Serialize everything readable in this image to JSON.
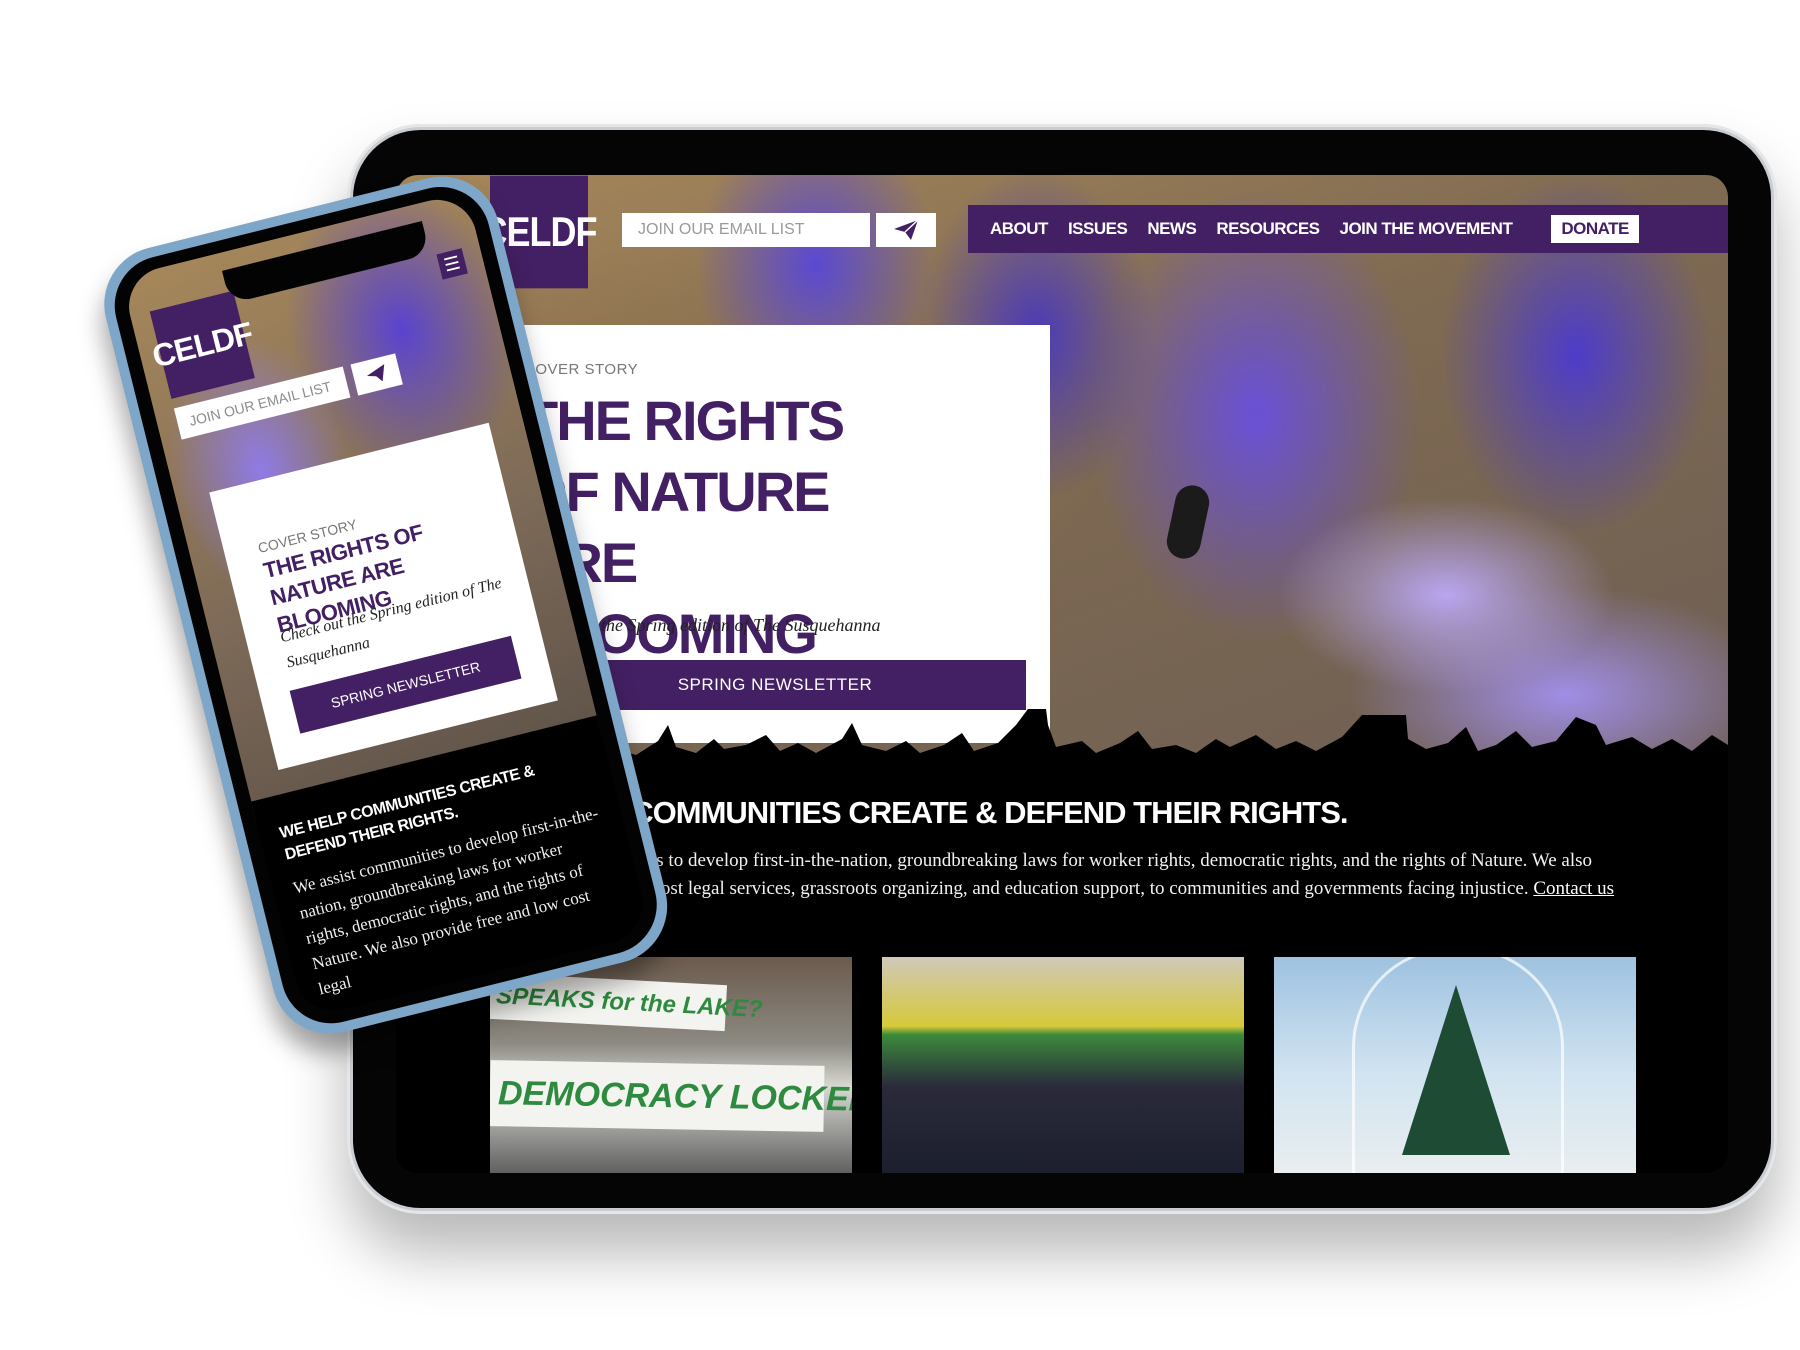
{
  "brand": {
    "logo_text": "CELDF",
    "accent": "#432063"
  },
  "header": {
    "email_placeholder": "JOIN OUR EMAIL LIST",
    "send_icon": "paper-plane-icon",
    "nav": [
      "ABOUT",
      "ISSUES",
      "NEWS",
      "RESOURCES",
      "JOIN THE MOVEMENT"
    ],
    "donate_label": "DONATE"
  },
  "cover": {
    "kicker": "COVER STORY",
    "title": "THE RIGHTS OF NATURE ARE BLOOMING",
    "subtitle": "Check out the Spring edition of The Susquehanna",
    "button_label": "SPRING NEWSLETTER"
  },
  "mission": {
    "heading": "WE HELP COMMUNITIES CREATE & DEFEND THEIR RIGHTS.",
    "body": "We assist communities to develop first-in-the-nation, groundbreaking laws for worker rights, democratic rights, and the rights of Nature. We also provide free and low cost legal services, grassroots organizing, and education support, to communities and governments facing injustice.",
    "link_label": "Contact us now",
    "link_suffix": "."
  },
  "thumbnails": {
    "banner_1": "SPEAKS for the LAKE?",
    "banner_2": "DEMOCRACY LOCKED OUT!"
  },
  "mobile": {
    "menu_icon": "hamburger-menu-icon",
    "email_placeholder": "JOIN OUR EMAIL LIST",
    "body_excerpt": "We assist communities to develop first-in-the-nation, groundbreaking laws for worker rights, democratic rights, and the rights of Nature. We also provide free and low cost legal"
  }
}
